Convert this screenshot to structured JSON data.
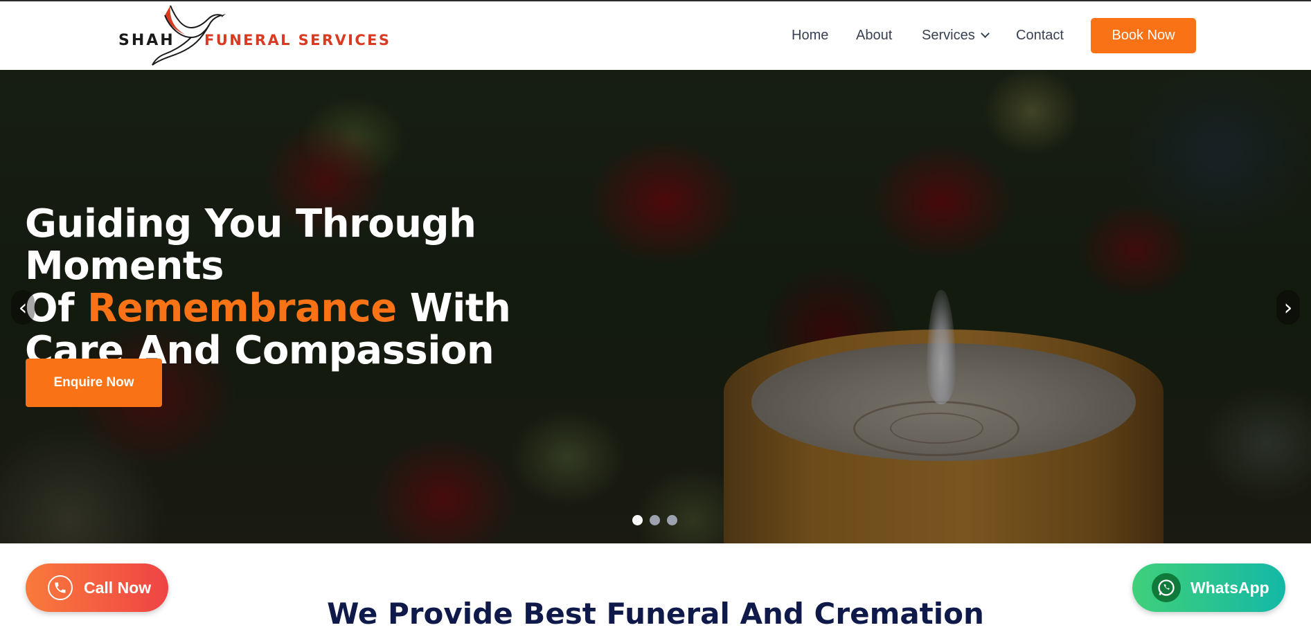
{
  "brand": {
    "logo_word_1": "SHAH",
    "logo_word_2": "FUNERAL SERVICES",
    "accent_color": "#d83a22",
    "logo_icon": "bird-icon"
  },
  "nav": {
    "items": [
      {
        "label": "Home"
      },
      {
        "label": "About"
      },
      {
        "label": "Services",
        "icon": "chevron-down-icon"
      },
      {
        "label": "Contact"
      }
    ],
    "cta_label": "Book Now",
    "cta_color": "#f97316"
  },
  "hero": {
    "title_part_1": "Guiding You Through Moments",
    "title_part_2_before": "Of ",
    "title_part_2_accent": "Remembrance",
    "title_part_2_after": " With",
    "title_part_3": "Care And Compassion",
    "enquire_label": "Enquire Now",
    "prev_arrow": "‹",
    "next_arrow": "›",
    "slides_total": 3,
    "active_slide": 1
  },
  "floating": {
    "call_label": "Call Now",
    "call_icon": "phone-icon",
    "whatsapp_label": "WhatsApp",
    "whatsapp_icon": "whatsapp-icon"
  },
  "section": {
    "title": "We Provide Best Funeral And Cremation"
  }
}
